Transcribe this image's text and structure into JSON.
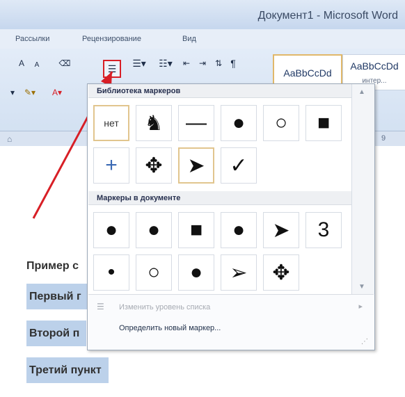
{
  "window": {
    "title": "Документ1 - Microsoft Word"
  },
  "ribbon_tabs": [
    "Рассылки",
    "Рецензирование",
    "Вид"
  ],
  "ribbon": {
    "font_grow": "A",
    "font_shrink": "A",
    "style_normal": "AaBbCcDd",
    "style_no_spacing": "AaBbCcDd",
    "style_label": "интер..."
  },
  "ruler_mark": "9",
  "document_lines": [
    "Пример с",
    "Первый г",
    "Второй п",
    "Третий пункт"
  ],
  "bullet_menu": {
    "section_library": "Библиотека маркеров",
    "library": [
      "нет",
      "♞",
      "—",
      "●",
      "○",
      "■",
      "+",
      "✥",
      "➤",
      "✓"
    ],
    "section_document": "Маркеры в документе",
    "document_markers": [
      "●",
      "●",
      "■",
      "●",
      "➤",
      "3",
      "•",
      "○",
      "●",
      "➢",
      "✥"
    ],
    "change_level": "Изменить уровень списка",
    "define_new": "Определить новый маркер..."
  }
}
